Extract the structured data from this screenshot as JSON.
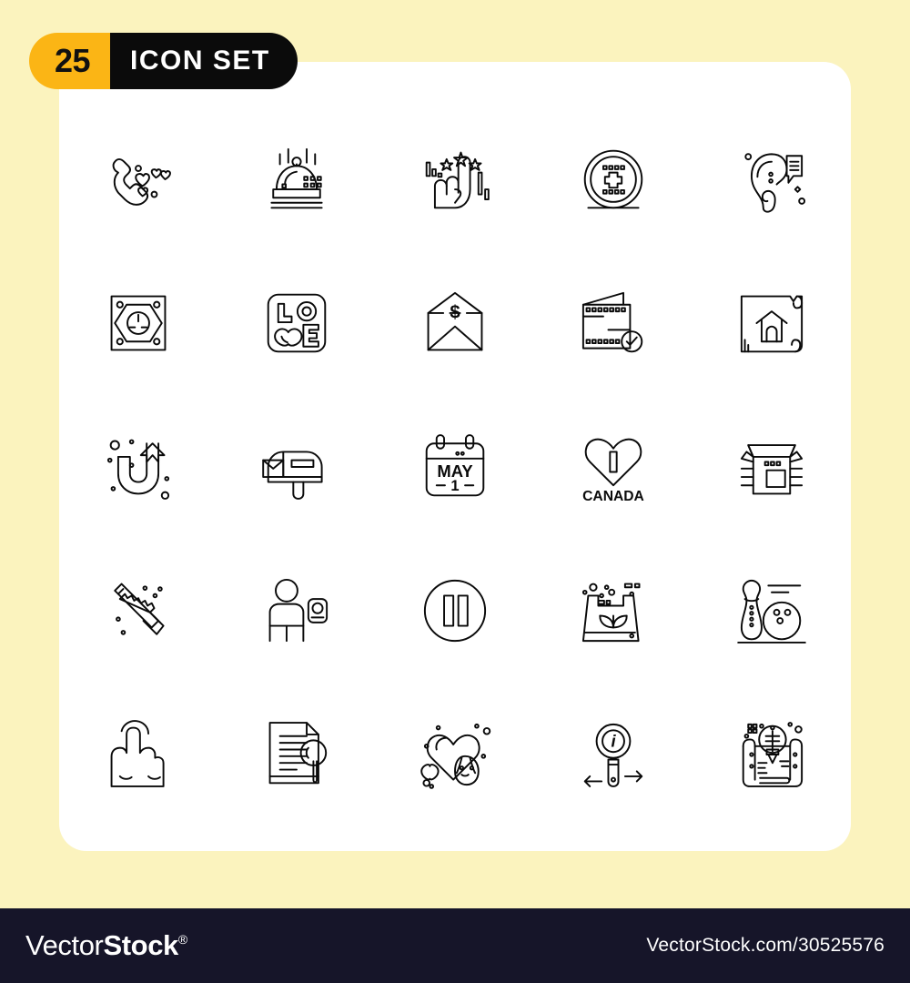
{
  "badge": {
    "count": "25",
    "label": "ICON SET",
    "count_bg": "#FBB515",
    "label_bg": "#0B0B0B"
  },
  "canvas": {
    "background": "#FBF3BE",
    "card_background": "#FFFFFF",
    "stroke_color": "#0A0A0A"
  },
  "grid": {
    "rows": 5,
    "columns": 5,
    "total": 25,
    "icons": [
      {
        "id": "phone-love-icon",
        "name": "phone call with hearts"
      },
      {
        "id": "food-cloche-icon",
        "name": "food serving dish cover"
      },
      {
        "id": "hand-one-stars-icon",
        "name": "hand number one with stars"
      },
      {
        "id": "add-coin-plus-icon",
        "name": "circle with plus sign"
      },
      {
        "id": "ear-listen-icon",
        "name": "ear with speech bubble"
      },
      {
        "id": "power-socket-icon",
        "name": "electric wall socket"
      },
      {
        "id": "love-letters-icon",
        "name": "love word block with heart"
      },
      {
        "id": "money-envelope-icon",
        "name": "open envelope with dollar"
      },
      {
        "id": "wallet-check-icon",
        "name": "wallet with checkmark"
      },
      {
        "id": "house-blueprint-icon",
        "name": "rolled blueprint with house"
      },
      {
        "id": "u-turn-arrow-icon",
        "name": "u turn magnet arrow"
      },
      {
        "id": "mailbox-letter-icon",
        "name": "mailbox with letter"
      },
      {
        "id": "calendar-may-1-icon",
        "name": "calendar may 1"
      },
      {
        "id": "i-love-canada-icon",
        "name": "i love canada heart"
      },
      {
        "id": "open-box-icon",
        "name": "open shipping box"
      },
      {
        "id": "hand-saw-icon",
        "name": "hand saw tool"
      },
      {
        "id": "person-badge-icon",
        "name": "person with id badge"
      },
      {
        "id": "pause-circle-icon",
        "name": "pause button in circle"
      },
      {
        "id": "eco-bag-icon",
        "name": "eco bag with leaves"
      },
      {
        "id": "bowling-icon",
        "name": "bowling pin and ball"
      },
      {
        "id": "tap-gesture-icon",
        "name": "hand tap gesture"
      },
      {
        "id": "document-search-icon",
        "name": "document with magnifier"
      },
      {
        "id": "heart-girl-icon",
        "name": "heart with girl face"
      },
      {
        "id": "info-search-icon",
        "name": "magnifier with info and arrows"
      },
      {
        "id": "idea-scroll-icon",
        "name": "lightbulb on scroll blueprint"
      }
    ],
    "icon_labels": {
      "love_word_l": "L",
      "love_word_o": "O",
      "love_word_e": "E",
      "dollar_sign": "$",
      "calendar_month": "MAY",
      "calendar_day": "1",
      "canada_i": "I",
      "canada_word": "CANADA",
      "info_letter": "i"
    }
  },
  "footer": {
    "logo_light": "Vector",
    "logo_bold": "Stock",
    "logo_reg": "®",
    "url": "VectorStock.com/30525576",
    "background": "#161529"
  }
}
